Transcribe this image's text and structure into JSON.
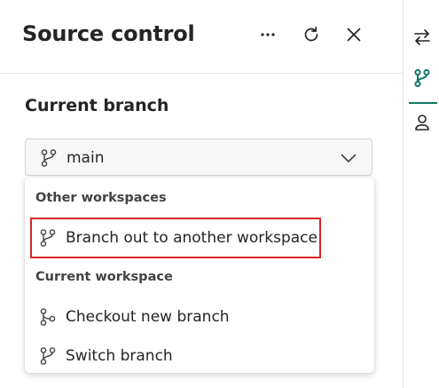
{
  "panel": {
    "title": "Source control",
    "header_icons": [
      "more-icon",
      "refresh-icon",
      "close-icon"
    ]
  },
  "current_branch": {
    "label": "Current branch",
    "selected": "main",
    "icon": "branch-icon"
  },
  "menu": {
    "groups": [
      {
        "label": "Other workspaces",
        "items": [
          {
            "label": "Branch out to another workspace",
            "icon": "branch-out-icon"
          }
        ]
      },
      {
        "label": "Current workspace",
        "items": [
          {
            "label": "Checkout new branch",
            "icon": "checkout-branch-icon"
          },
          {
            "label": "Switch branch",
            "icon": "switch-branch-icon"
          }
        ]
      }
    ]
  },
  "rail": {
    "icons": [
      "swap-icon",
      "source-control-icon",
      "user-icon"
    ],
    "active_icon": "source-control-icon"
  },
  "colors": {
    "accent": "#117865",
    "highlight_border": "#d9262a",
    "text": "#242424"
  }
}
